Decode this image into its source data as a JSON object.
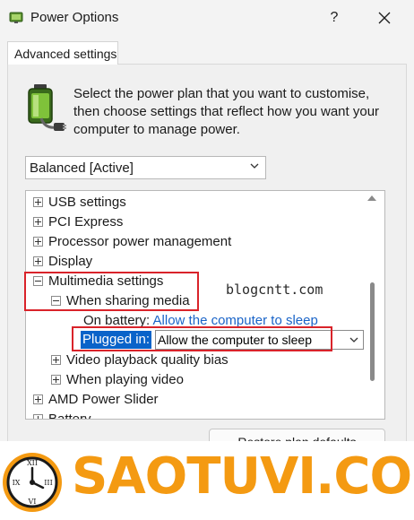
{
  "window": {
    "title": "Power Options",
    "help_label": "?",
    "close_label": "×"
  },
  "tab": {
    "label": "Advanced settings"
  },
  "intro": {
    "text": "Select the power plan that you want to customise, then choose settings that reflect how you want your computer to manage power."
  },
  "plan_select": {
    "value": "Balanced [Active]"
  },
  "tree": {
    "items": [
      {
        "label": "USB settings"
      },
      {
        "label": "PCI Express"
      },
      {
        "label": "Processor power management"
      },
      {
        "label": "Display"
      },
      {
        "label": "Multimedia settings"
      },
      {
        "label": "When sharing media"
      },
      {
        "label": "On battery:",
        "value": "Allow the computer to sleep"
      },
      {
        "label": "Plugged in:",
        "value": "Allow the computer to sleep"
      },
      {
        "label": "Video playback quality bias"
      },
      {
        "label": "When playing video"
      },
      {
        "label": "AMD Power Slider"
      },
      {
        "label": "Battery"
      }
    ]
  },
  "watermark": "blogcntt.com",
  "restore_button": "Restore plan defaults",
  "brand": {
    "text": "SAOTUVI.COM"
  },
  "colors": {
    "accent": "#0a63c9",
    "link": "#1a64c8",
    "highlight_box": "#d9232a",
    "brand": "#f49a12"
  }
}
